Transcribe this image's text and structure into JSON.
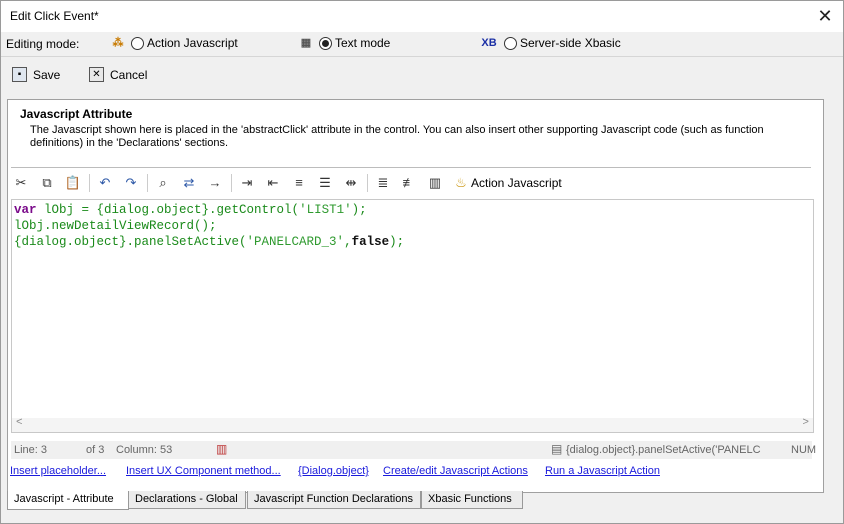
{
  "window": {
    "title": "Edit Click Event*",
    "close": "✕"
  },
  "mode": {
    "label": "Editing mode:",
    "options": [
      {
        "label": "Action Javascript",
        "selected": false,
        "icon": "action-javascript-icon"
      },
      {
        "label": "Text mode",
        "selected": true,
        "icon": "text-mode-icon"
      },
      {
        "label": "Server-side Xbasic",
        "selected": false,
        "icon": "xbasic-icon",
        "icon_text": "XB"
      }
    ]
  },
  "commands": {
    "save": "Save",
    "cancel": "Cancel"
  },
  "panel": {
    "title": "Javascript Attribute",
    "description": "The Javascript shown here is placed in the 'abstractClick' attribute in the control. You can also insert other supporting Javascript code (such as function definitions) in the 'Declarations' sections."
  },
  "toolbar": {
    "action_js": "Action Javascript"
  },
  "code": {
    "line1": "var lObj = {dialog.object}.getControl('LIST1');",
    "line2": "lObj.newDetailViewRecord();",
    "line3": "{dialog.object}.panelSetActive('PANELCARD_3',false);"
  },
  "status": {
    "line": "Line: 3",
    "of": "of 3",
    "column": "Column: 53",
    "context": "{dialog.object}.panelSetActive('PANELC",
    "num": "NUM"
  },
  "links": [
    "Insert placeholder...",
    "Insert UX Component method...",
    "{Dialog.object}",
    "Create/edit Javascript Actions",
    "Run a Javascript Action"
  ],
  "tabs": [
    {
      "label": "Javascript - Attribute",
      "active": true
    },
    {
      "label": "Declarations - Global",
      "active": false
    },
    {
      "label": "Javascript Function Declarations",
      "active": false
    },
    {
      "label": "Xbasic Functions",
      "active": false
    }
  ],
  "colors": {
    "keyword": "#7a0a8a",
    "string": "#2f9a2f",
    "code": "#1a8a1a",
    "link": "#1a1adc"
  }
}
